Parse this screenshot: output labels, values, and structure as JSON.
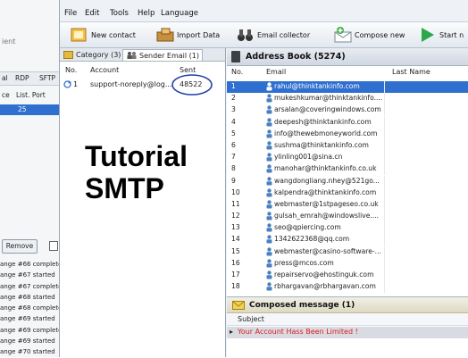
{
  "background_window": {
    "partial_label": "ient",
    "tabs": [
      "al",
      "RDP",
      "SFTP"
    ],
    "columns": [
      "ce",
      "List. Port"
    ],
    "selected_row": {
      "port": "25"
    },
    "remove_label": "Remove",
    "log": [
      "ange #66 complete",
      "ange #67 started",
      "ange #67 complete",
      "ange #68 started",
      "ange #68 complete",
      "ange #69 started",
      "ange #69 complete",
      "ange #69 started",
      "ange #70 started"
    ]
  },
  "menu": [
    "File",
    "Edit",
    "Tools",
    "Help",
    "Language"
  ],
  "toolbar": {
    "new_contact": "New contact",
    "import_data": "Import Data",
    "email_collector": "Email collector",
    "compose_new": "Compose new",
    "start": "Start n"
  },
  "sender_panel": {
    "tabs": [
      "Category (3)",
      "Sender Email (1)"
    ],
    "columns": {
      "no": "No.",
      "account": "Account",
      "sent": "Sent"
    },
    "rows": [
      {
        "no": "1",
        "account": "support-noreply@log...",
        "sent": "48522"
      }
    ]
  },
  "overlay_text": [
    "Tutorial",
    "SMTP"
  ],
  "address_book": {
    "title": "Address Book (5274)",
    "columns": {
      "no": "No.",
      "email": "Email",
      "last_name": "Last Name"
    },
    "rows": [
      {
        "no": "1",
        "email": "rahul@thinktankinfo.com"
      },
      {
        "no": "2",
        "email": "mukeshkumar@thinktankinfo...."
      },
      {
        "no": "3",
        "email": "arsalan@coveringwindows.com"
      },
      {
        "no": "4",
        "email": "deepesh@thinktankinfo.com"
      },
      {
        "no": "5",
        "email": "info@thewebmoneyworld.com"
      },
      {
        "no": "6",
        "email": "sushma@thinktankinfo.com"
      },
      {
        "no": "7",
        "email": "ylinling001@sina.cn"
      },
      {
        "no": "8",
        "email": "manohar@thinktankinfo.co.uk"
      },
      {
        "no": "9",
        "email": "wangdongliang.nhey@521go..."
      },
      {
        "no": "10",
        "email": "kalpendra@thinktankinfo.com"
      },
      {
        "no": "11",
        "email": "webmaster@1stpageseo.co.uk"
      },
      {
        "no": "12",
        "email": "gulsah_emrah@windowslive...."
      },
      {
        "no": "13",
        "email": "seo@qpiercing.com"
      },
      {
        "no": "14",
        "email": "1342622368@qq.com"
      },
      {
        "no": "15",
        "email": "webmaster@casino-software-..."
      },
      {
        "no": "16",
        "email": "press@mcos.com"
      },
      {
        "no": "17",
        "email": "repairservo@ehostinguk.com"
      },
      {
        "no": "18",
        "email": "rbhargavan@rbhargavan.com"
      }
    ]
  },
  "composed": {
    "title": "Composed message (1)",
    "column": "Subject",
    "rows": [
      "Your Account Hass Been Limited !"
    ]
  },
  "colors": {
    "selection": "#2f6fd0",
    "annotation": "#1f3fa8",
    "subject_text": "#e01a1a"
  }
}
